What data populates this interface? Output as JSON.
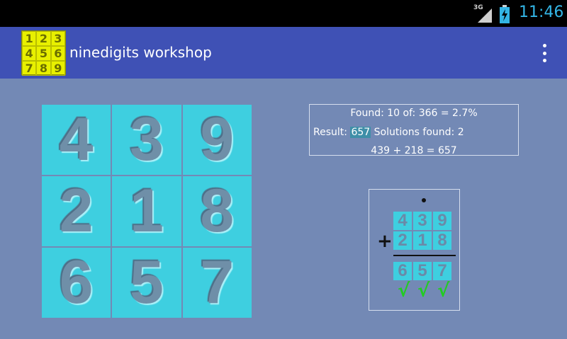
{
  "status_bar": {
    "network": "3G",
    "time": "11:46"
  },
  "app_bar": {
    "logo_digits": [
      "1",
      "2",
      "3",
      "4",
      "5",
      "6",
      "7",
      "8",
      "9"
    ],
    "title": "ninedigits workshop"
  },
  "grid": {
    "cells": [
      "4",
      "3",
      "9",
      "2",
      "1",
      "8",
      "6",
      "5",
      "7"
    ]
  },
  "info": {
    "found_text": "Found: 10 of: 366 = 2.7%",
    "result_label": "Result:",
    "result_value": "657",
    "solutions_text": "Solutions found: 2",
    "equation": "439 + 218 = 657"
  },
  "calc": {
    "row1": [
      "4",
      "3",
      "9"
    ],
    "row2": [
      "2",
      "1",
      "8"
    ],
    "sum": [
      "6",
      "5",
      "7"
    ],
    "operator": "+",
    "check": "√"
  },
  "colors": {
    "background": "#7389b5",
    "app_bar": "#3f51b5",
    "cell": "#3ecfe0",
    "logo": "#e8f000",
    "check": "#22cc22",
    "time": "#33b5e5"
  }
}
